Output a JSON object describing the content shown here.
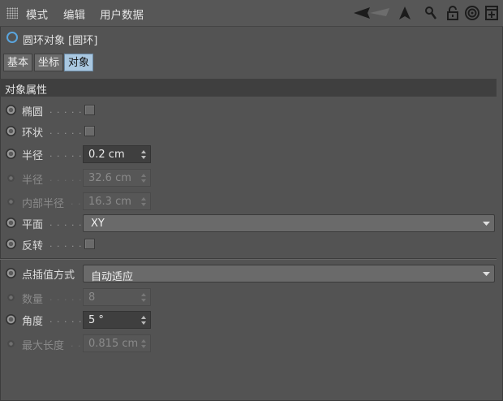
{
  "menu": {
    "items": [
      "模式",
      "编辑",
      "用户数据"
    ]
  },
  "object": {
    "title": "圆环对象 [圆环]"
  },
  "tabs": [
    {
      "label": "基本",
      "active": false
    },
    {
      "label": "坐标",
      "active": false
    },
    {
      "label": "对象",
      "active": true
    }
  ],
  "section": {
    "title": "对象属性"
  },
  "fields": {
    "ellipse": {
      "label": "椭圆"
    },
    "ring": {
      "label": "环状"
    },
    "radius": {
      "label": "半径",
      "value": "0.2 cm"
    },
    "radius2": {
      "label": "半径",
      "value": "32.6 cm"
    },
    "inner_radius": {
      "label": "内部半径",
      "value": "16.3 cm"
    },
    "plane": {
      "label": "平面",
      "value": "XY"
    },
    "reverse": {
      "label": "反转"
    },
    "interpolation": {
      "label": "点插值方式",
      "value": "自动适应"
    },
    "count": {
      "label": "数量",
      "value": "8"
    },
    "angle": {
      "label": "角度",
      "value": "5 °"
    },
    "max_length": {
      "label": "最大长度",
      "value": "0.815 cm"
    }
  },
  "colors": {
    "accent": "#5aa5dd",
    "active_tab": "#a9c7e0",
    "background": "#535353"
  }
}
